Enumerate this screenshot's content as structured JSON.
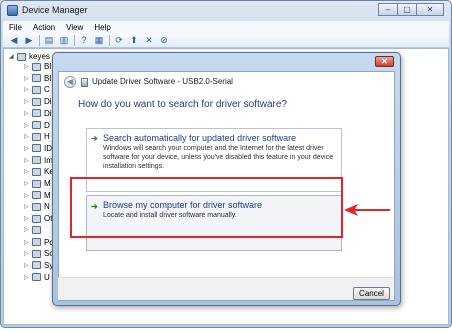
{
  "device_manager": {
    "title": "Device Manager",
    "menu": [
      "File",
      "Action",
      "View",
      "Help"
    ],
    "window_buttons": {
      "minimize": "–",
      "maximize": "▢",
      "close": "✕"
    },
    "tree": {
      "root_label": "keyes",
      "items": [
        {
          "label": "Bl",
          "icon": "computer-icon"
        },
        {
          "label": "Bl",
          "icon": "bluetooth-icon"
        },
        {
          "label": "C",
          "icon": "computer-icon"
        },
        {
          "label": "Di",
          "icon": "disk-drive-icon"
        },
        {
          "label": "Di",
          "icon": "display-adapter-icon"
        },
        {
          "label": "D",
          "icon": "dvd-drive-icon"
        },
        {
          "label": "H",
          "icon": "hid-icon"
        },
        {
          "label": "ID",
          "icon": "ide-controller-icon"
        },
        {
          "label": "Im",
          "icon": "imaging-device-icon"
        },
        {
          "label": "Ke",
          "icon": "keyboard-icon"
        },
        {
          "label": "M",
          "icon": "mouse-icon"
        },
        {
          "label": "M",
          "icon": "monitor-icon"
        },
        {
          "label": "N",
          "icon": "network-adapter-icon"
        },
        {
          "label": "Ot",
          "icon": "other-devices-icon"
        },
        {
          "label": "",
          "icon": "unknown-device-icon"
        },
        {
          "label": "Pc",
          "icon": "ports-icon"
        },
        {
          "label": "Sc",
          "icon": "sound-icon"
        },
        {
          "label": "Sy",
          "icon": "system-devices-icon"
        },
        {
          "label": "U",
          "icon": "usb-controller-icon"
        }
      ]
    }
  },
  "dialog": {
    "title": "Update Driver Software - USB2.0-Serial",
    "close_label": "✕",
    "heading": "How do you want to search for driver software?",
    "options": [
      {
        "title": "Search automatically for updated driver software",
        "description": "Windows will search your computer and the Internet for the latest driver software for your device, unless you've disabled this feature in your device installation settings."
      },
      {
        "title": "Browse my computer for driver software",
        "description": "Locate and install driver software manually."
      }
    ],
    "cancel_label": "Cancel"
  },
  "colors": {
    "annotation_red": "#e0262a",
    "link_blue": "#1e3c87",
    "arrow_green": "#2c8a2e"
  }
}
